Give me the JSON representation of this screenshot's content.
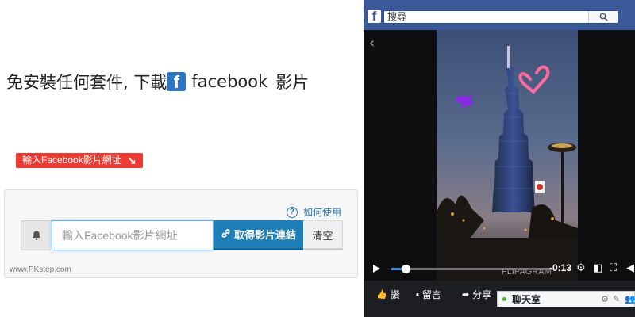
{
  "downloader": {
    "headline_prefix": "免安裝任何套件, 下載",
    "brand_word": "facebook",
    "headline_suffix": "影片",
    "logo_letter": "f",
    "tag_label": "輸入Facebook影片網址",
    "tag_arrow": "↘",
    "howto_label": "如何使用",
    "input_placeholder": "輸入Facebook影片網址",
    "input_value": "",
    "get_link_label": "取得影片連結",
    "clear_label": "清空",
    "watermark": "www.PKstep.com",
    "colors": {
      "tag_red": "#ee3b33",
      "button_blue": "#1e7fb8",
      "link_blue": "#2a7ab5"
    }
  },
  "facebook": {
    "logo_letter": "f",
    "search_placeholder": "搜尋",
    "brand_color": "#3b5998",
    "video": {
      "time_remaining": "-0:13",
      "progress": 0.09,
      "overlay_text": "FLIPAGRAM"
    },
    "actions": {
      "like": "讚",
      "comment": "留言",
      "share": "分享"
    },
    "chat": {
      "label": "聊天室"
    }
  }
}
